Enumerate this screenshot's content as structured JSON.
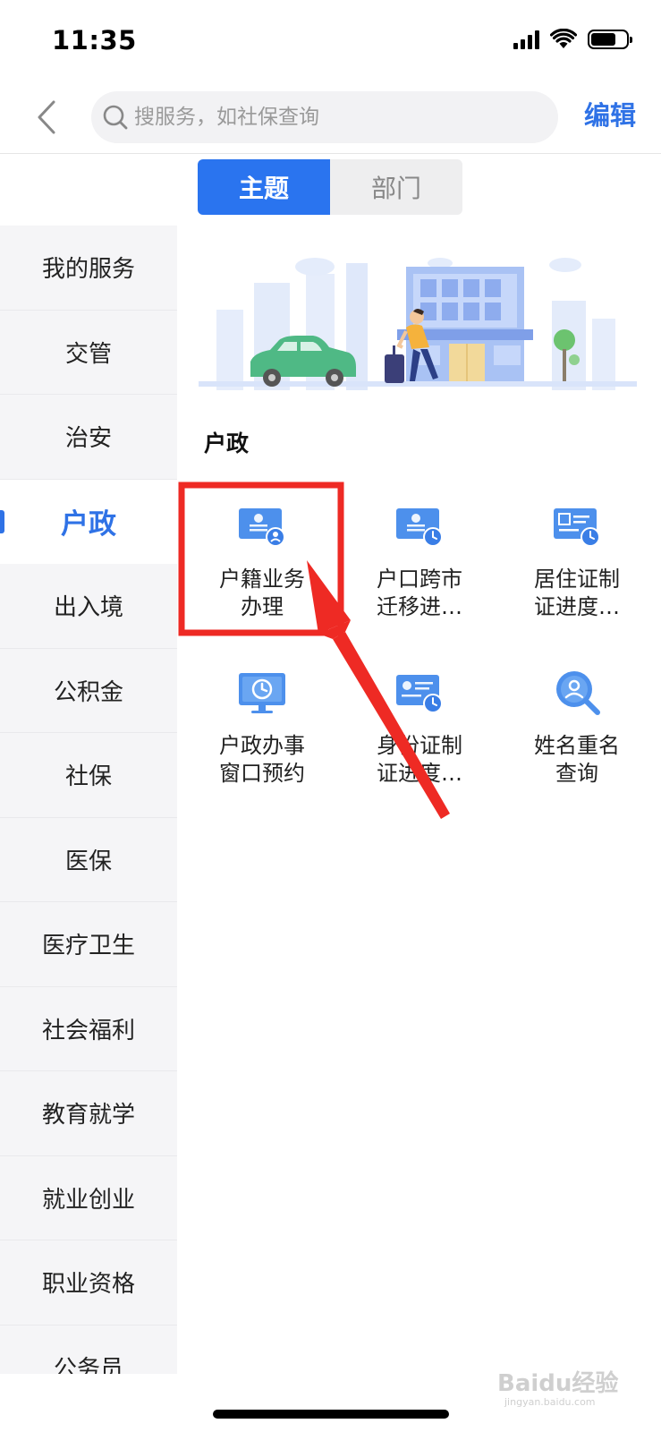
{
  "status_bar": {
    "time": "11:35"
  },
  "nav": {
    "search_placeholder": "搜服务，如社保查询",
    "edit_label": "编辑"
  },
  "tabs": [
    {
      "label": "主题",
      "active": true
    },
    {
      "label": "部门",
      "active": false
    }
  ],
  "sidebar": {
    "items": [
      {
        "label": "我的服务"
      },
      {
        "label": "交管"
      },
      {
        "label": "治安"
      },
      {
        "label": "户政",
        "active": true
      },
      {
        "label": "出入境"
      },
      {
        "label": "公积金"
      },
      {
        "label": "社保"
      },
      {
        "label": "医保"
      },
      {
        "label": "医疗卫生"
      },
      {
        "label": "社会福利"
      },
      {
        "label": "教育就学"
      },
      {
        "label": "就业创业"
      },
      {
        "label": "职业资格"
      },
      {
        "label": "公务员"
      }
    ]
  },
  "main": {
    "section_title": "户政",
    "services": [
      {
        "line1": "户籍业务",
        "line2": "办理",
        "icon": "id-card-person-icon"
      },
      {
        "line1": "户口跨市",
        "line2": "迁移进…",
        "icon": "id-card-clock-icon"
      },
      {
        "line1": "居住证制",
        "line2": "证进度…",
        "icon": "residence-card-clock-icon"
      },
      {
        "line1": "户政办事",
        "line2": "窗口预约",
        "icon": "monitor-clock-icon"
      },
      {
        "line1": "身份证制",
        "line2": "证进度…",
        "icon": "id-card-clock-icon"
      },
      {
        "line1": "姓名重名",
        "line2": "查询",
        "icon": "search-person-icon"
      }
    ]
  },
  "watermark": {
    "brand": "Baidu经验",
    "url": "jingyan.baidu.com"
  },
  "colors": {
    "accent": "#2f72e6",
    "active_tab": "#2a74ef",
    "highlight_box": "#ee2a24",
    "sidebar_bg": "#f5f5f7"
  }
}
